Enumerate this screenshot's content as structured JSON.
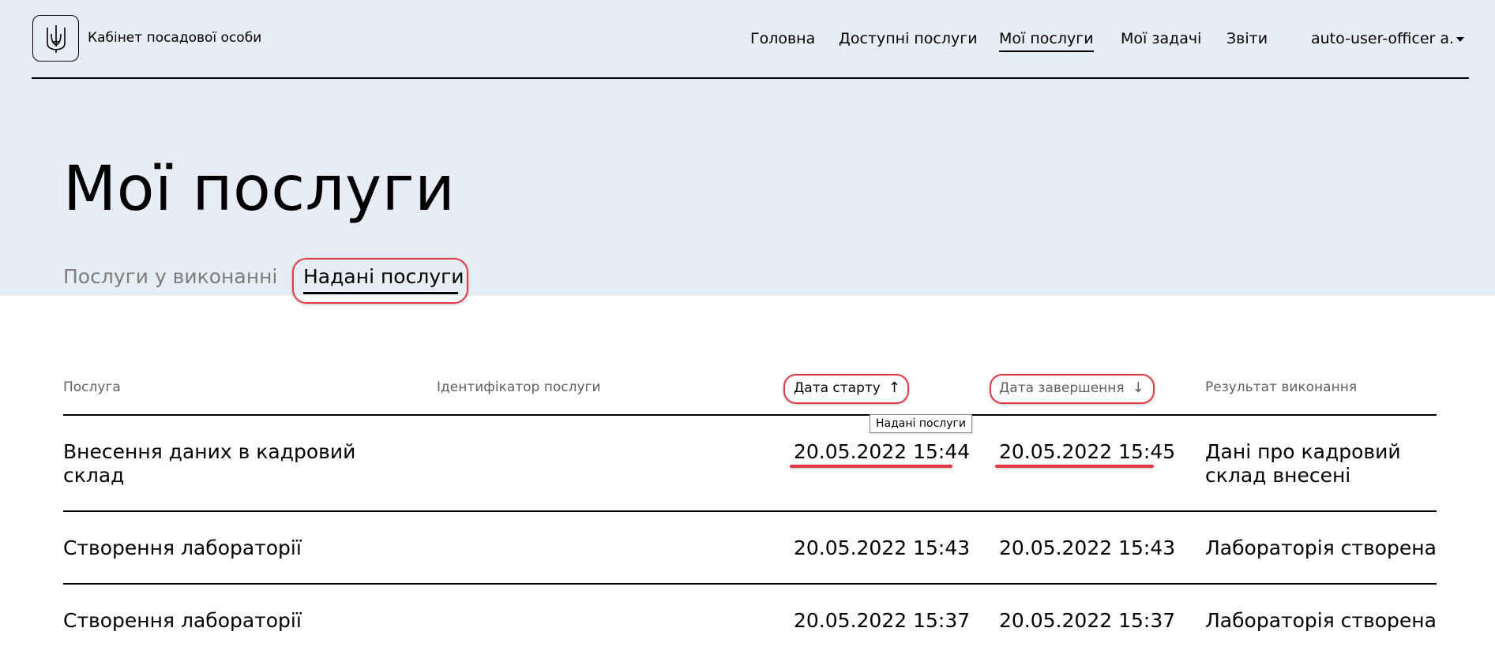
{
  "header": {
    "brand": "Кабінет посадової особи",
    "nav": [
      {
        "label": "Головна"
      },
      {
        "label": "Доступні послуги"
      },
      {
        "label": "Мої послуги"
      },
      {
        "label": "Мої задачі"
      },
      {
        "label": "Звіти"
      }
    ],
    "user": "auto-user-officer a."
  },
  "page": {
    "title": "Мої послуги",
    "tabs": [
      {
        "label": "Послуги у виконанні"
      },
      {
        "label": "Надані послуги"
      }
    ]
  },
  "table": {
    "columns": [
      {
        "label": "Послуга"
      },
      {
        "label": "Ідентифікатор послуги"
      },
      {
        "label": "Дата старту",
        "sort": "↑"
      },
      {
        "label": "Дата завершення",
        "sort": "↓"
      },
      {
        "label": "Результат виконання"
      }
    ],
    "rows": [
      {
        "service": "Внесення даних в кадровий склад",
        "id": "",
        "start": "20.05.2022 15:44",
        "end": "20.05.2022 15:45",
        "result": "Дані про кадровий склад внесені"
      },
      {
        "service": "Створення лабораторії",
        "id": "",
        "start": "20.05.2022 15:43",
        "end": "20.05.2022 15:43",
        "result": "Лабораторія створена"
      },
      {
        "service": "Створення лабораторії",
        "id": "",
        "start": "20.05.2022 15:37",
        "end": "20.05.2022 15:37",
        "result": "Лабораторія створена"
      }
    ]
  },
  "tooltip": "Надані послуги",
  "colors": {
    "hero_bg": "#e6edf4",
    "annotation_red": "#e03a45"
  }
}
